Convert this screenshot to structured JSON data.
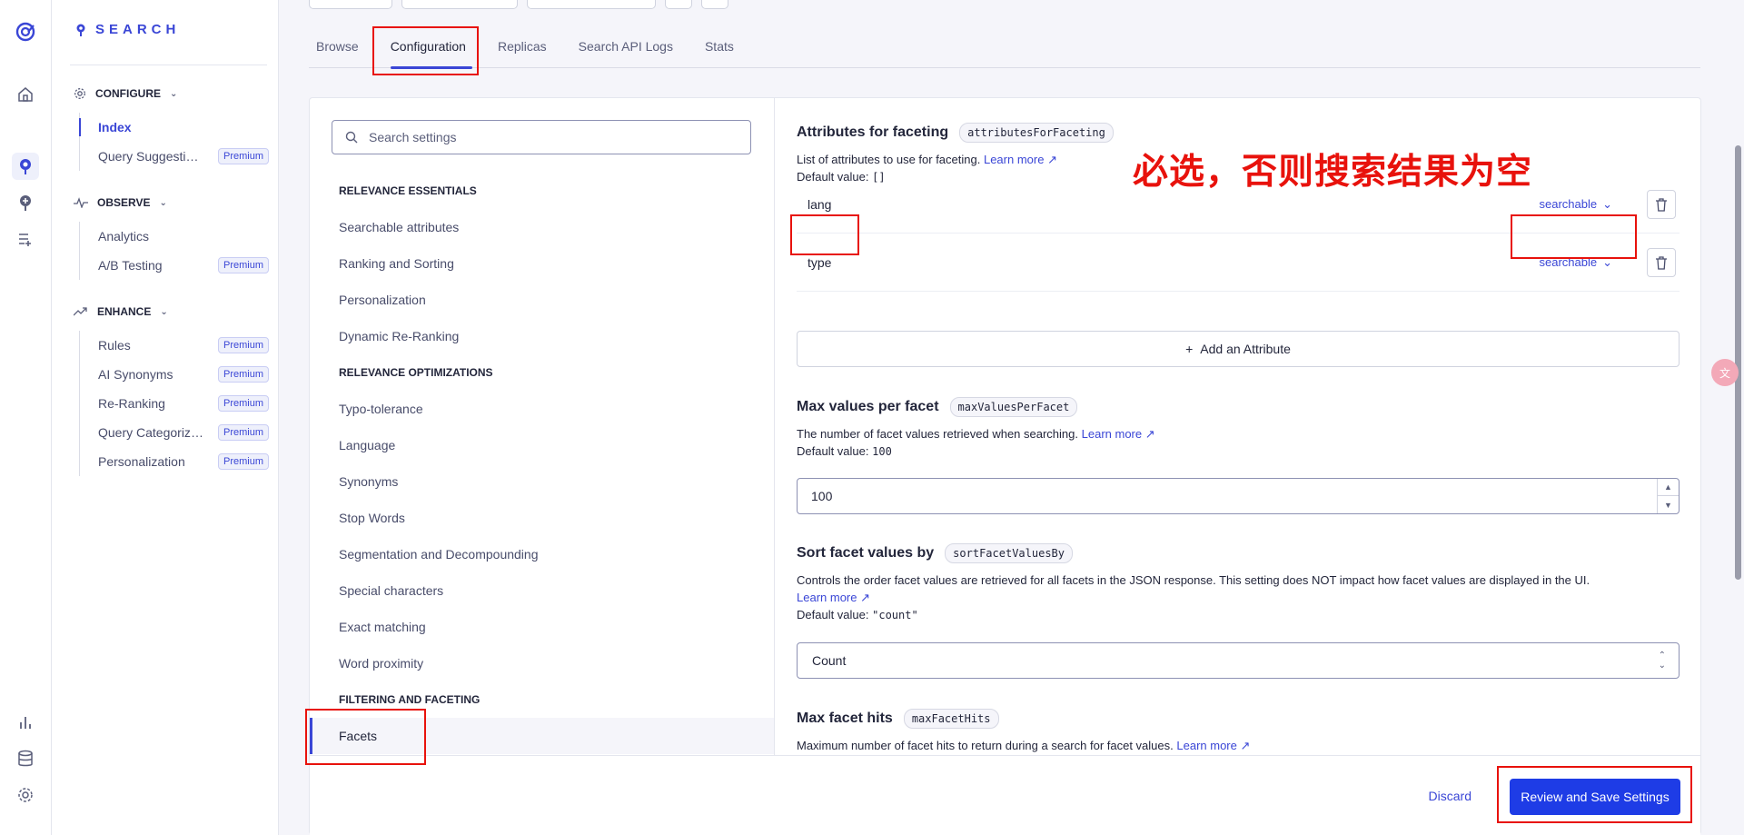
{
  "brand": {
    "name": "SEARCH"
  },
  "sidebar": {
    "configure": {
      "label": "CONFIGURE",
      "items": [
        {
          "label": "Index",
          "active": true
        },
        {
          "label": "Query Suggestions",
          "badge": "Premium"
        }
      ]
    },
    "observe": {
      "label": "OBSERVE",
      "items": [
        {
          "label": "Analytics"
        },
        {
          "label": "A/B Testing",
          "badge": "Premium"
        }
      ]
    },
    "enhance": {
      "label": "ENHANCE",
      "items": [
        {
          "label": "Rules",
          "badge": "Premium"
        },
        {
          "label": "AI Synonyms",
          "badge": "Premium"
        },
        {
          "label": "Re-Ranking",
          "badge": "Premium"
        },
        {
          "label": "Query Categorization",
          "badge": "Premium"
        },
        {
          "label": "Personalization",
          "badge": "Premium"
        }
      ]
    }
  },
  "tabs": [
    "Browse",
    "Configuration",
    "Replicas",
    "Search API Logs",
    "Stats"
  ],
  "active_tab": "Configuration",
  "settings_search": {
    "placeholder": "Search settings"
  },
  "nav": {
    "relevance_essentials": {
      "heading": "RELEVANCE ESSENTIALS",
      "items": [
        "Searchable attributes",
        "Ranking and Sorting",
        "Personalization",
        "Dynamic Re-Ranking"
      ]
    },
    "relevance_optimizations": {
      "heading": "RELEVANCE OPTIMIZATIONS",
      "items": [
        "Typo-tolerance",
        "Language",
        "Synonyms",
        "Stop Words",
        "Segmentation and Decompounding",
        "Special characters",
        "Exact matching",
        "Word proximity"
      ]
    },
    "filtering": {
      "heading": "FILTERING AND FACETING",
      "items": [
        "Facets"
      ]
    }
  },
  "faceting": {
    "title": "Attributes for faceting",
    "code": "attributesForFaceting",
    "desc": "List of attributes to use for faceting.",
    "learn_more": "Learn more",
    "default_label": "Default value:",
    "default_value": "[]",
    "attributes": [
      {
        "name": "lang",
        "mode": "searchable"
      },
      {
        "name": "type",
        "mode": "searchable"
      }
    ],
    "add_label": "Add an Attribute"
  },
  "max_values": {
    "title": "Max values per facet",
    "code": "maxValuesPerFacet",
    "desc": "The number of facet values retrieved when searching.",
    "learn_more": "Learn more",
    "default_label": "Default value:",
    "default_value": "100",
    "value": "100"
  },
  "sort_facet": {
    "title": "Sort facet values by",
    "code": "sortFacetValuesBy",
    "desc": "Controls the order facet values are retrieved for all facets in the JSON response. This setting does NOT impact how facet values are displayed in the UI.",
    "learn_more": "Learn more",
    "default_label": "Default value:",
    "default_value": "\"count\"",
    "selected": "Count"
  },
  "max_hits": {
    "title": "Max facet hits",
    "code": "maxFacetHits",
    "desc": "Maximum number of facet hits to return during a search for facet values.",
    "learn_more": "Learn more"
  },
  "footer": {
    "discard": "Discard",
    "save": "Review and Save Settings"
  },
  "annotation": {
    "text": "必选，否则搜索结果为空"
  },
  "colors": {
    "accent": "#3a46d6",
    "primary_button": "#1e3ce6",
    "annotation": "#e8120c"
  }
}
